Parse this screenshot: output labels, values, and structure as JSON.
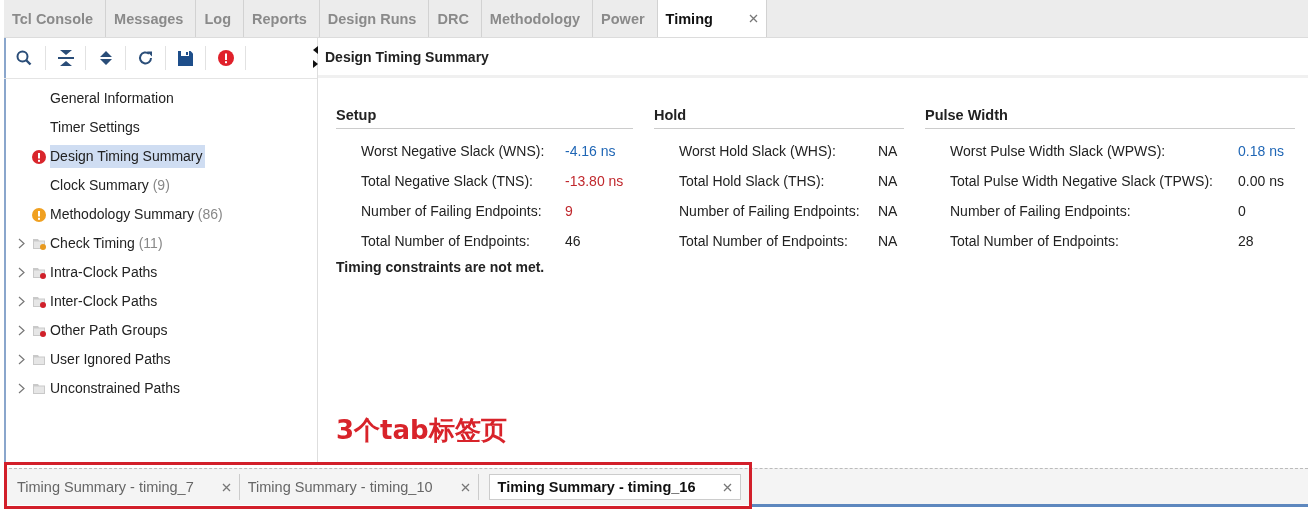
{
  "tabs": [
    {
      "label": "Tcl Console",
      "selected": false,
      "closable": false
    },
    {
      "label": "Messages",
      "selected": false,
      "closable": false
    },
    {
      "label": "Log",
      "selected": false,
      "closable": false
    },
    {
      "label": "Reports",
      "selected": false,
      "closable": false
    },
    {
      "label": "Design Runs",
      "selected": false,
      "closable": false
    },
    {
      "label": "DRC",
      "selected": false,
      "closable": false
    },
    {
      "label": "Methodology",
      "selected": false,
      "closable": false
    },
    {
      "label": "Power",
      "selected": false,
      "closable": false
    },
    {
      "label": "Timing",
      "selected": true,
      "closable": true
    }
  ],
  "panel_title": "Design Timing Summary",
  "tree": [
    {
      "kind": "leaf",
      "label": "General Information",
      "error": false,
      "warning": false,
      "selected": false
    },
    {
      "kind": "leaf",
      "label": "Timer Settings",
      "error": false,
      "warning": false,
      "selected": false
    },
    {
      "kind": "leaf",
      "label": "Design Timing Summary",
      "error": true,
      "warning": false,
      "selected": true
    },
    {
      "kind": "leaf",
      "label": "Clock Summary",
      "count": "(9)",
      "error": false,
      "warning": false,
      "selected": false
    },
    {
      "kind": "leaf",
      "label": "Methodology Summary",
      "count": "(86)",
      "error": false,
      "warning": true,
      "selected": false
    },
    {
      "kind": "folder",
      "label": "Check Timing",
      "count": "(11)",
      "error": false,
      "warning": true,
      "expanded": false,
      "selected": false
    },
    {
      "kind": "folder",
      "label": "Intra-Clock Paths",
      "error": true,
      "warning": false,
      "expanded": false,
      "selected": false
    },
    {
      "kind": "folder",
      "label": "Inter-Clock Paths",
      "error": true,
      "warning": false,
      "expanded": false,
      "selected": false
    },
    {
      "kind": "folder",
      "label": "Other Path Groups",
      "error": true,
      "warning": false,
      "expanded": false,
      "selected": false
    },
    {
      "kind": "folder",
      "label": "User Ignored Paths",
      "error": false,
      "warning": false,
      "expanded": false,
      "selected": false
    },
    {
      "kind": "folder",
      "label": "Unconstrained Paths",
      "error": false,
      "warning": false,
      "expanded": false,
      "selected": false
    }
  ],
  "sections": [
    {
      "title": "Setup",
      "rows": [
        {
          "label": "Worst Negative Slack (WNS):",
          "value": "-4.16 ns",
          "link": true,
          "failing": false
        },
        {
          "label": "Total Negative Slack (TNS):",
          "value": "-13.80 ns",
          "link": false,
          "failing": true
        },
        {
          "label": "Number of Failing Endpoints:",
          "value": "9",
          "link": false,
          "failing": true
        },
        {
          "label": "Total Number of Endpoints:",
          "value": "46",
          "link": false,
          "failing": false
        }
      ]
    },
    {
      "title": "Hold",
      "rows": [
        {
          "label": "Worst Hold Slack (WHS):",
          "value": "NA",
          "link": false,
          "failing": false
        },
        {
          "label": "Total Hold Slack (THS):",
          "value": "NA",
          "link": false,
          "failing": false
        },
        {
          "label": "Number of Failing Endpoints:",
          "value": "NA",
          "link": false,
          "failing": false
        },
        {
          "label": "Total Number of Endpoints:",
          "value": "NA",
          "link": false,
          "failing": false
        }
      ]
    },
    {
      "title": "Pulse Width",
      "rows": [
        {
          "label": "Worst Pulse Width Slack (WPWS):",
          "value": "0.18 ns",
          "link": true,
          "failing": false
        },
        {
          "label": "Total Pulse Width Negative Slack (TPWS):",
          "value": "0.00 ns",
          "link": false,
          "failing": false
        },
        {
          "label": "Number of Failing Endpoints:",
          "value": "0",
          "link": false,
          "failing": false
        },
        {
          "label": "Total Number of Endpoints:",
          "value": "28",
          "link": false,
          "failing": false
        }
      ]
    }
  ],
  "message": "Timing constraints are not met.",
  "annotation": "3个tab标签页",
  "result_tabs": [
    {
      "label": "Timing Summary - timing_7",
      "selected": false
    },
    {
      "label": "Timing Summary - timing_10",
      "selected": false
    },
    {
      "label": "Timing Summary - timing_16",
      "selected": true
    }
  ]
}
